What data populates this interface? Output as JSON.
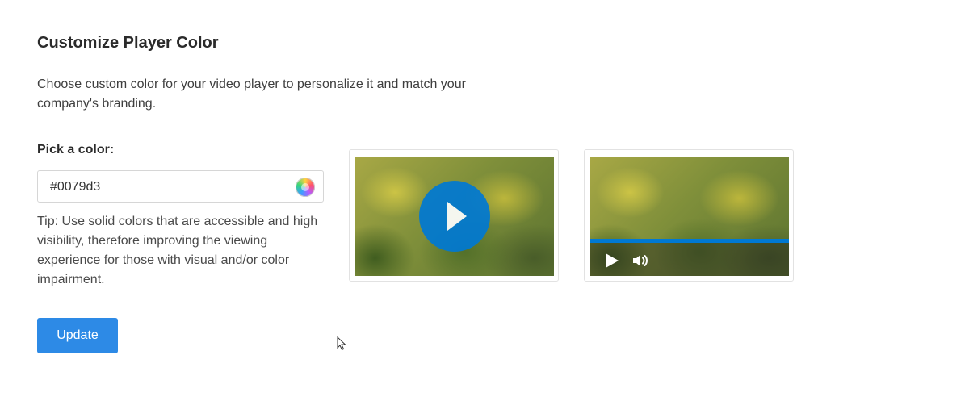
{
  "page": {
    "title": "Customize Player Color",
    "description": "Choose custom color for your video player to personalize it and match your company's branding."
  },
  "color_picker": {
    "label": "Pick a color:",
    "value": "#0079d3",
    "swatch_icon": "color-wheel-icon"
  },
  "tip": "Tip: Use solid colors that are accessible and high visibility, therefore improving the viewing experience for those with visual and/or color impairment.",
  "actions": {
    "update_label": "Update"
  },
  "previews": {
    "accent_color": "#0079d3",
    "big_play_icon": "play-icon",
    "control_icons": [
      "play-icon",
      "volume-icon"
    ]
  },
  "colors": {
    "button_bg": "#2d8ae6",
    "player_accent": "#0079d3"
  }
}
